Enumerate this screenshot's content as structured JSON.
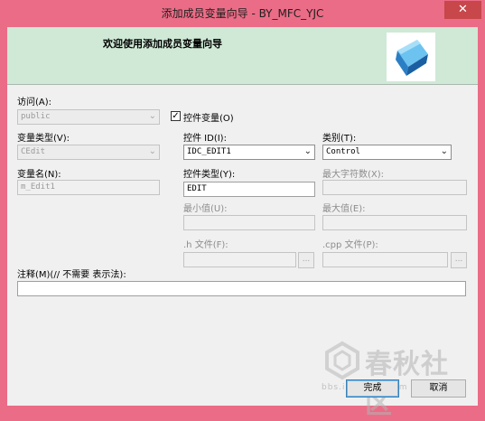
{
  "window": {
    "title": "添加成员变量向导 - BY_MFC_YJC",
    "close_glyph": "✕"
  },
  "banner": {
    "heading": "欢迎使用添加成员变量向导"
  },
  "access": {
    "label": "访问(A):",
    "value": "public"
  },
  "control_variable": {
    "label": "控件变量(O)",
    "checked": true,
    "check_glyph": "✓"
  },
  "variable_type": {
    "label": "变量类型(V):",
    "value": "CEdit"
  },
  "control_id": {
    "label": "控件 ID(I):",
    "value": "IDC_EDIT1"
  },
  "category": {
    "label": "类别(T):",
    "value": "Control"
  },
  "variable_name": {
    "label": "变量名(N):",
    "value": "m_Edit1"
  },
  "control_type": {
    "label": "控件类型(Y):",
    "value": "EDIT"
  },
  "max_chars": {
    "label": "最大字符数(X):",
    "value": ""
  },
  "min_value": {
    "label": "最小值(U):",
    "value": ""
  },
  "max_value": {
    "label": "最大值(E):",
    "value": ""
  },
  "h_file": {
    "label": ".h 文件(F):",
    "value": "",
    "browse": "..."
  },
  "cpp_file": {
    "label": ".cpp 文件(P):",
    "value": "",
    "browse": "..."
  },
  "comment": {
    "label": "注释(M)(// 不需要 表示法):",
    "value": ""
  },
  "buttons": {
    "finish": "完成",
    "cancel": "取消"
  },
  "watermark": {
    "brand": "春秋社区",
    "url": "bbs.ichunqiu.com"
  },
  "icons": {
    "dropdown_arrow": "⌄"
  }
}
